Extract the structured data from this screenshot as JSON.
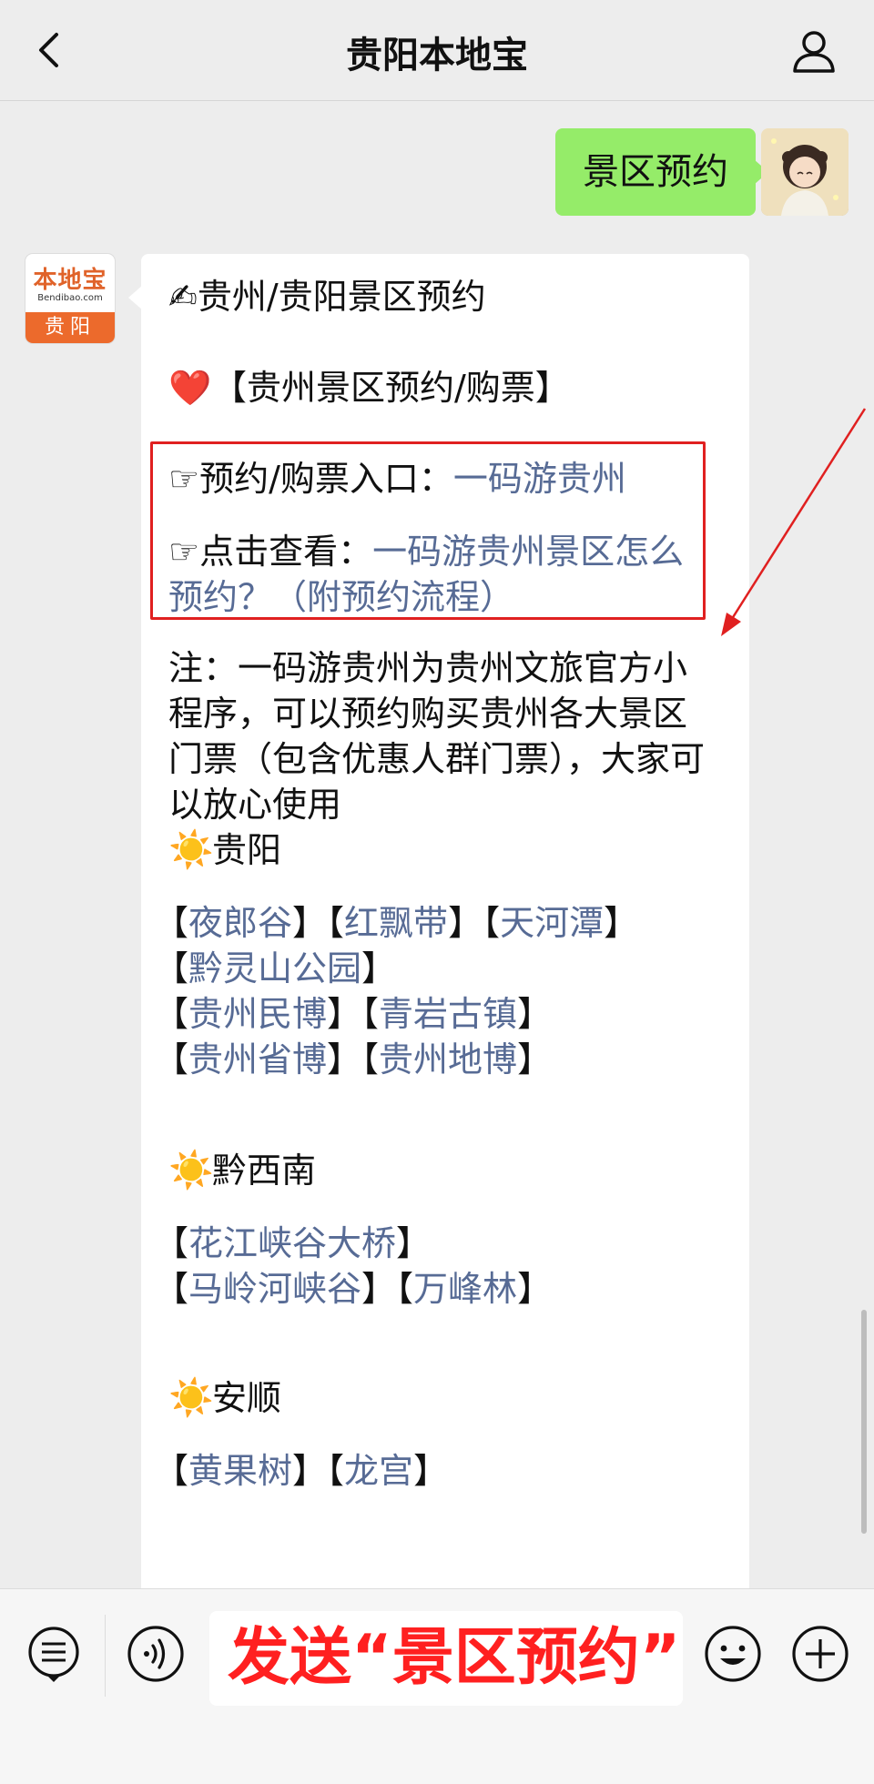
{
  "header": {
    "title": "贵阳本地宝"
  },
  "outgoing": {
    "text": "景区预约"
  },
  "bot": {
    "logo_text": "本地宝",
    "logo_sub": "Bendibao.com",
    "logo_city": "贵阳"
  },
  "message": {
    "line1": "✍贵州/贵阳景区预约",
    "line2_emoji": "❤️",
    "line2": "【贵州景区预约/购票】",
    "entry_label": "☞预约/购票入口：",
    "entry_link": "一码游贵州",
    "view_label": "☞点击查看：",
    "view_link_1": "一码游贵州景区怎么",
    "view_link_2": "预约？（附预约流程）",
    "note_1": "注：一码游贵州为贵州文旅官方小",
    "note_2": "程序，可以预约购买贵州各大景区",
    "note_3": "门票（包含优惠人群门票），大家可",
    "note_4": "以放心使用",
    "sun": "☀️",
    "guiyang_title": "贵阳",
    "guiyang_links": [
      "夜郎谷",
      "红飘带",
      "天河潭",
      "黔灵山公园",
      "贵州民博",
      "青岩古镇",
      "贵州省博",
      "贵州地博"
    ],
    "qianxinan_title": "黔西南",
    "qianxinan_links": [
      "花江峡谷大桥",
      "马岭河峡谷",
      "万峰林"
    ],
    "anshun_title": "安顺",
    "anshun_links": [
      "黄果树",
      "龙宫"
    ]
  },
  "input": {
    "value": "发送“景区预约”"
  },
  "colors": {
    "link": "#576b95",
    "bubble_out": "#95ec69",
    "highlight": "#e02020",
    "input_text": "#ff2020"
  }
}
